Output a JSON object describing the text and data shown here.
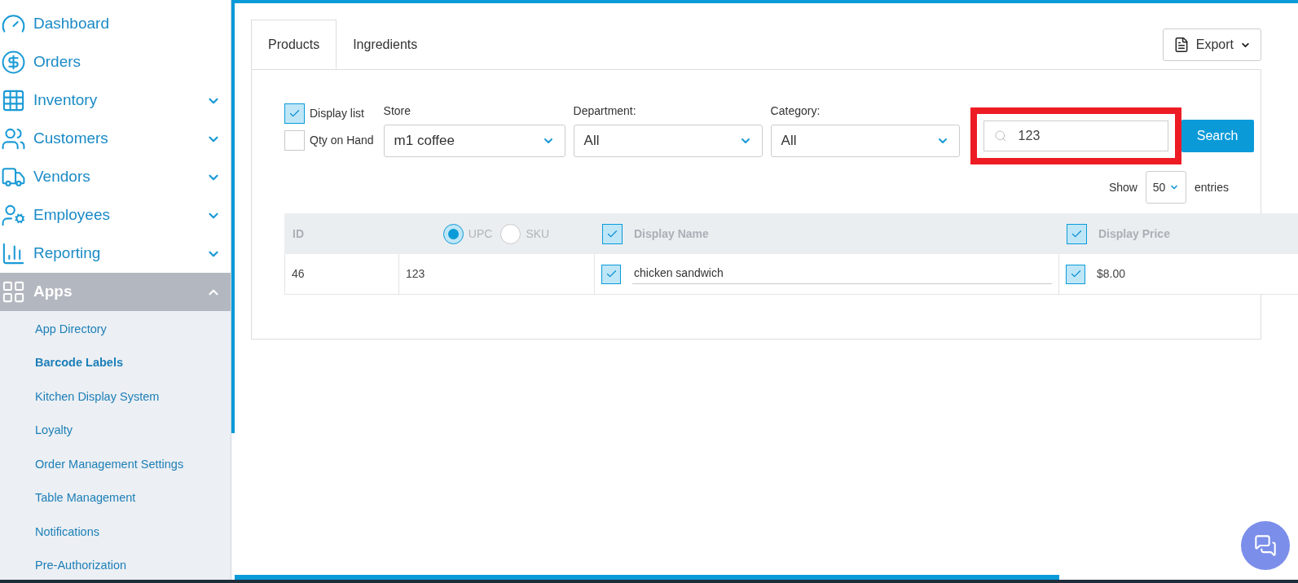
{
  "sidebar": {
    "items": [
      {
        "label": "Dashboard",
        "selected": false
      },
      {
        "label": "Orders",
        "selected": false
      },
      {
        "label": "Inventory",
        "selected": false,
        "expanded": false
      },
      {
        "label": "Customers",
        "selected": false,
        "expanded": false
      },
      {
        "label": "Vendors",
        "selected": false,
        "expanded": false
      },
      {
        "label": "Employees",
        "selected": false,
        "expanded": false
      },
      {
        "label": "Reporting",
        "selected": false,
        "expanded": false
      },
      {
        "label": "Apps",
        "selected": true,
        "expanded": true,
        "children": [
          {
            "label": "App Directory",
            "selected": false
          },
          {
            "label": "Barcode Labels",
            "selected": true
          },
          {
            "label": "Kitchen Display System",
            "selected": false
          },
          {
            "label": "Loyalty",
            "selected": false
          },
          {
            "label": "Order Management Settings",
            "selected": false
          },
          {
            "label": "Table Management",
            "selected": false
          },
          {
            "label": "Notifications",
            "selected": false
          },
          {
            "label": "Pre-Authorization",
            "selected": false
          }
        ]
      }
    ]
  },
  "tabs": [
    {
      "label": "Products",
      "selected": true
    },
    {
      "label": "Ingredients",
      "selected": false
    }
  ],
  "export_button": {
    "label": "Export"
  },
  "filters": {
    "checkboxes": [
      {
        "label": "Display list",
        "checked": true
      },
      {
        "label": "Qty on Hand",
        "checked": false
      }
    ],
    "selects": [
      {
        "label": "Store",
        "value": "m1 coffee"
      },
      {
        "label": "Department:",
        "value": "All"
      },
      {
        "label": "Category:",
        "value": "All"
      }
    ],
    "search": {
      "value": "123",
      "highlighted": true
    },
    "search_button": "Search"
  },
  "show_entries": {
    "prefix": "Show",
    "value": "50",
    "suffix": "entries"
  },
  "table": {
    "columns": [
      {
        "kind": "text",
        "label": "ID"
      },
      {
        "kind": "radio",
        "options": [
          {
            "label": "UPC",
            "selected": true
          },
          {
            "label": "SKU",
            "selected": false
          }
        ]
      },
      {
        "kind": "check",
        "label": "Display Name",
        "checked": true
      },
      {
        "kind": "check",
        "label": "Display Price",
        "checked": true
      }
    ],
    "rows": [
      {
        "cells": [
          {
            "kind": "text",
            "value": "46"
          },
          {
            "kind": "text",
            "value": "123"
          },
          {
            "kind": "input",
            "value": "chicken sandwich",
            "checked": true
          },
          {
            "kind": "check",
            "value": "$8.00",
            "checked": true
          }
        ]
      }
    ]
  }
}
